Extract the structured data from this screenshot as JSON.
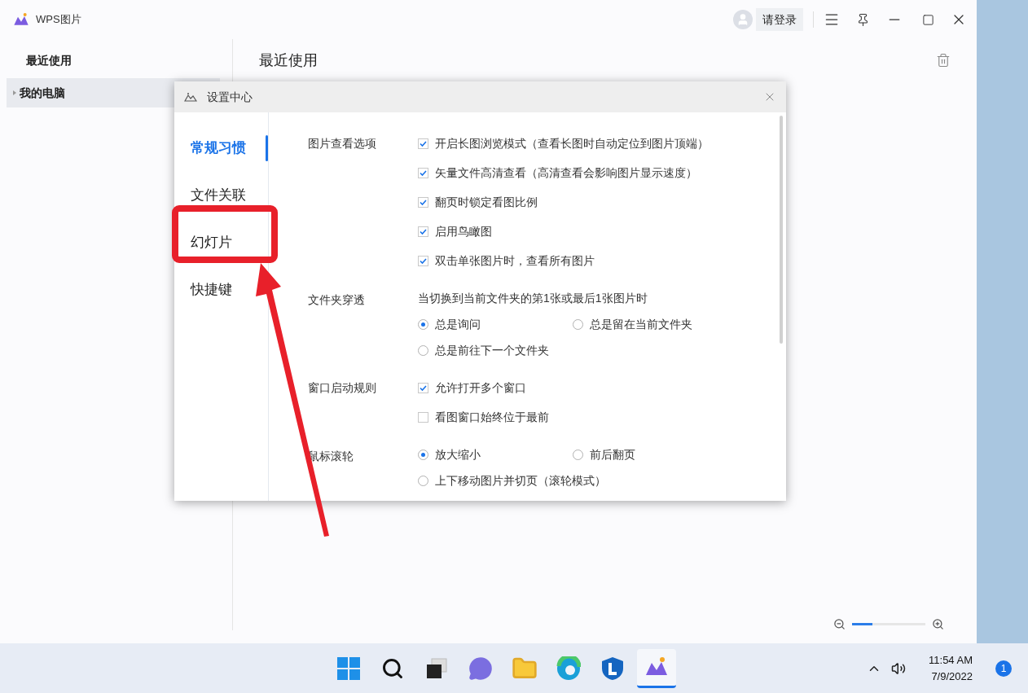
{
  "window": {
    "title": "WPS图片",
    "login": "请登录"
  },
  "sidebar": {
    "items": [
      {
        "label": "最近使用",
        "selected": false,
        "expandable": false
      },
      {
        "label": "我的电脑",
        "selected": true,
        "expandable": true
      }
    ]
  },
  "main": {
    "heading": "最近使用",
    "zoom": {
      "level": 0.28
    }
  },
  "dialog": {
    "title": "设置中心",
    "nav": [
      {
        "label": "常规习惯",
        "selected": true
      },
      {
        "label": "文件关联",
        "selected": false
      },
      {
        "label": "幻灯片",
        "selected": false
      },
      {
        "label": "快捷键",
        "selected": false
      }
    ],
    "sections": [
      {
        "label": "图片查看选项",
        "items": [
          {
            "kind": "checkbox",
            "label": "开启长图浏览模式（查看长图时自动定位到图片顶端）",
            "checked": true
          },
          {
            "kind": "checkbox",
            "label": "矢量文件高清查看（高清查看会影响图片显示速度）",
            "checked": true
          },
          {
            "kind": "checkbox",
            "label": "翻页时锁定看图比例",
            "checked": true
          },
          {
            "kind": "checkbox",
            "label": "启用鸟瞰图",
            "checked": true
          },
          {
            "kind": "checkbox",
            "label": "双击单张图片时，查看所有图片",
            "checked": true
          }
        ]
      },
      {
        "label": "文件夹穿透",
        "items": [
          {
            "kind": "note",
            "label": "当切换到当前文件夹的第1张或最后1张图片时"
          },
          {
            "kind": "radio",
            "label": "总是询问",
            "selected": true
          },
          {
            "kind": "radio",
            "label": "总是留在当前文件夹",
            "selected": false
          },
          {
            "kind": "radio",
            "label": "总是前往下一个文件夹",
            "selected": false
          }
        ]
      },
      {
        "label": "窗口启动规则",
        "items": [
          {
            "kind": "checkbox",
            "label": "允许打开多个窗口",
            "checked": true
          },
          {
            "kind": "checkbox",
            "label": "看图窗口始终位于最前",
            "checked": false
          }
        ]
      },
      {
        "label": "鼠标滚轮",
        "items": [
          {
            "kind": "radio",
            "label": "放大缩小",
            "selected": true
          },
          {
            "kind": "radio",
            "label": "前后翻页",
            "selected": false
          },
          {
            "kind": "radio",
            "label": "上下移动图片并切页（滚轮模式）",
            "selected": false
          }
        ]
      }
    ]
  },
  "taskbar": {
    "apps": [
      {
        "kind": "start",
        "active": false
      },
      {
        "kind": "search",
        "active": false
      },
      {
        "kind": "taskview",
        "active": false
      },
      {
        "kind": "chat",
        "active": false
      },
      {
        "kind": "folder",
        "active": false
      },
      {
        "kind": "browser",
        "active": false
      },
      {
        "kind": "shield",
        "active": false
      },
      {
        "kind": "wps",
        "active": true
      }
    ],
    "time": "11:54 AM",
    "date": "7/9/2022",
    "notifications": "1"
  }
}
